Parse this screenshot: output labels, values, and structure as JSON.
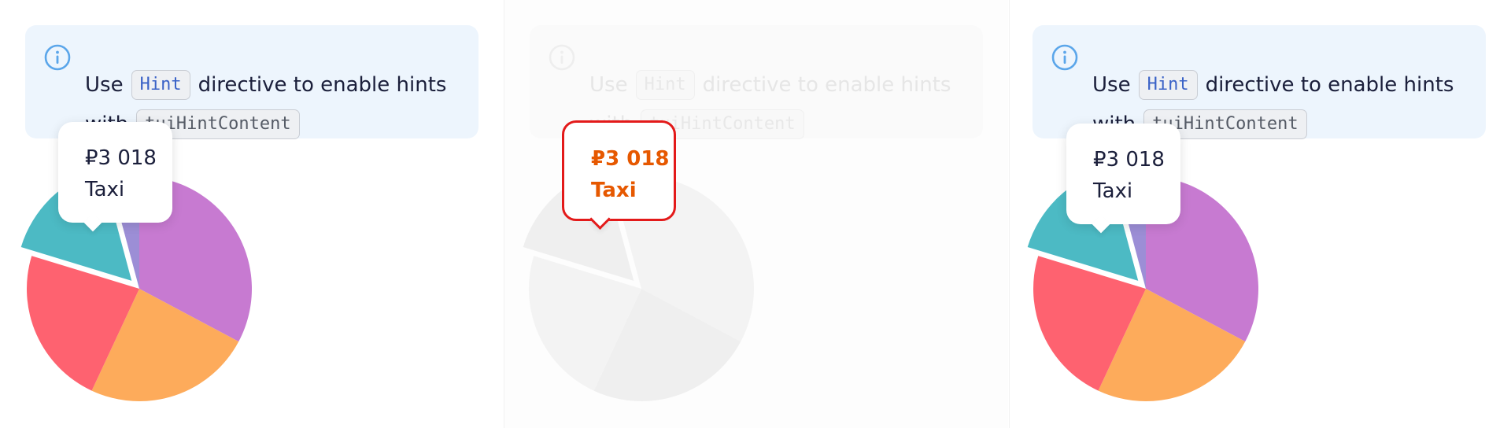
{
  "notice": {
    "word_use": "Use",
    "code_hint": "Hint",
    "text_directive": "directive to enable hints",
    "word_with": "with",
    "code_content": "tuiHintContent"
  },
  "hint": {
    "value": "₽3 018",
    "label": "Taxi"
  },
  "colors": {
    "notice_bg": "#edf5fd",
    "info_icon": "#5ba6ea",
    "purple": "#c77ad1",
    "orange": "#fdab5b",
    "red": "#fe6270",
    "teal": "#4cbac4",
    "lavender": "#9c8ed6",
    "faded_slice": "#f3f3f3",
    "faded_slice_alt": "#efefef",
    "error_outline": "#e31a1a"
  },
  "chart_data": [
    {
      "type": "pie",
      "panel": "left",
      "series": [
        {
          "label": "",
          "value": 118,
          "color": "#c77ad1"
        },
        {
          "label": "",
          "value": 87,
          "color": "#fdab5b"
        },
        {
          "label": "",
          "value": 82,
          "color": "#fe6270"
        },
        {
          "label": "Taxi",
          "value": 58,
          "color": "#4cbac4",
          "emphasized": true
        },
        {
          "label": "",
          "value": 15,
          "color": "#9c8ed6"
        }
      ],
      "tooltip": {
        "value": "₽3 018",
        "label": "Taxi"
      }
    },
    {
      "type": "pie",
      "panel": "middle",
      "faded": true,
      "series": [
        {
          "label": "",
          "value": 118,
          "color": "#f3f3f3"
        },
        {
          "label": "",
          "value": 87,
          "color": "#efefef"
        },
        {
          "label": "",
          "value": 82,
          "color": "#f3f3f3"
        },
        {
          "label": "Taxi",
          "value": 58,
          "color": "#efefef",
          "emphasized": true
        },
        {
          "label": "",
          "value": 15,
          "color": "#f3f3f3"
        }
      ],
      "tooltip": {
        "value": "₽3 018",
        "label": "Taxi"
      }
    },
    {
      "type": "pie",
      "panel": "right",
      "series": [
        {
          "label": "",
          "value": 118,
          "color": "#c77ad1"
        },
        {
          "label": "",
          "value": 87,
          "color": "#fdab5b"
        },
        {
          "label": "",
          "value": 82,
          "color": "#fe6270"
        },
        {
          "label": "Taxi",
          "value": 58,
          "color": "#4cbac4",
          "emphasized": true
        },
        {
          "label": "",
          "value": 15,
          "color": "#9c8ed6"
        }
      ],
      "tooltip": {
        "value": "₽3 018",
        "label": "Taxi"
      }
    }
  ]
}
